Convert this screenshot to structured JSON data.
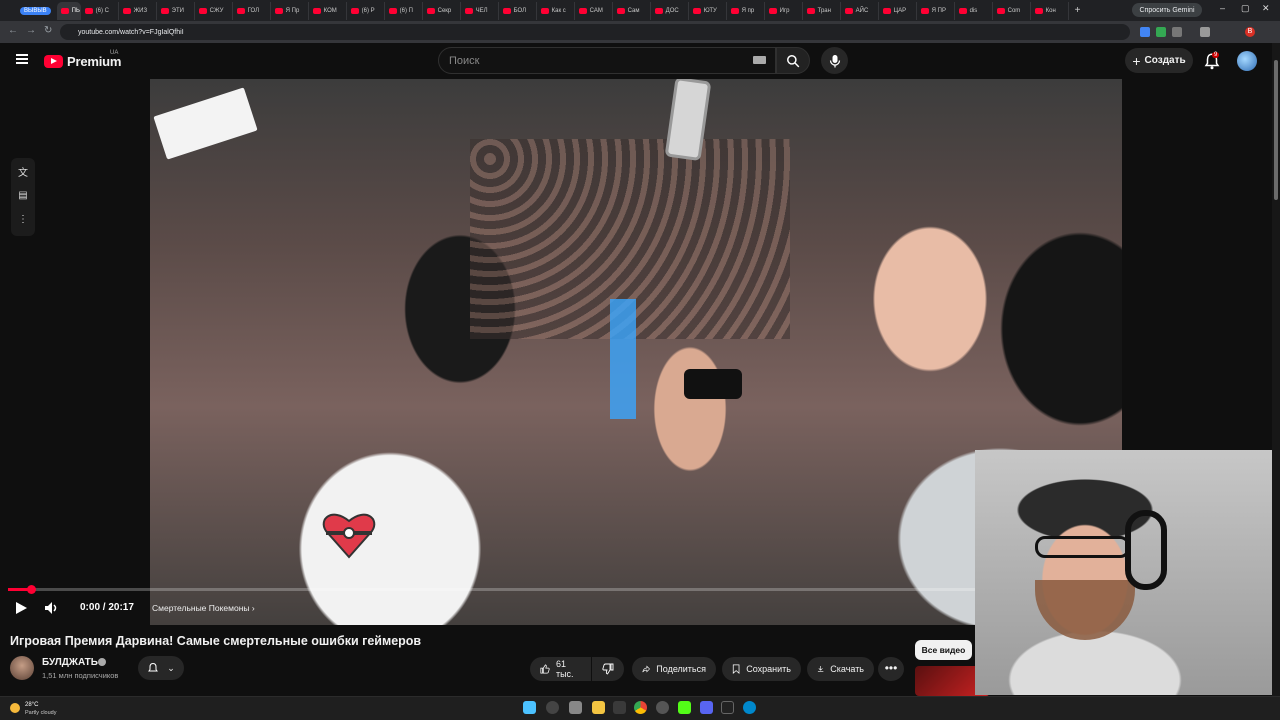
{
  "browser": {
    "profile_tab": "ВЫВЫВ",
    "tabs": [
      "ПЫТ",
      "(6) С",
      "ЖИЗ",
      "ЭТИ",
      "СЖУ",
      "ГОЛ",
      "Я Пр",
      "КОМ",
      "(6) Р",
      "(6) П",
      "Секр",
      "ЧЕЛ",
      "БОЛ",
      "Как с",
      "САМ",
      "Сам",
      "ДОС",
      "ЮТУ",
      "Я пр",
      "Игр",
      "Тран",
      "АЙС",
      "ЦАР",
      "Я ПР",
      "dis",
      "Com",
      "Кон"
    ],
    "gemini_button": "Спросить Gemini",
    "url": "youtube.com/watch?v=FJgIalQfhiI",
    "win_minimize": "–",
    "win_maximize": "▢",
    "win_close": "✕",
    "new_tab": "+",
    "profile_badge": "В"
  },
  "header": {
    "brand": "Premium",
    "region": "UA",
    "search_placeholder": "Поиск",
    "create_label": "Создать",
    "notification_count": "9"
  },
  "player": {
    "time": "0:00 / 20:17",
    "chapter": "Смертельные Покемоны",
    "chapter_arrow": "›",
    "progress": 0.02
  },
  "video": {
    "title": "Игровая Премия Дарвина! Самые смертельные ошибки геймеров",
    "channel": "БУЛДЖАТЬ",
    "subscribers": "1,51 млн подписчиков",
    "likes": "61 тыс.",
    "share_label": "Поделиться",
    "save_label": "Сохранить",
    "download_label": "Скачать",
    "more_label": "•••"
  },
  "sidebar_chip": {
    "all_videos": "Все видео"
  },
  "taskbar": {
    "temp": "28°C",
    "weather": "Partly cloudy"
  },
  "colors": {
    "accent": "#ff0033",
    "background": "#0f0f0f",
    "pill": "#272727"
  }
}
